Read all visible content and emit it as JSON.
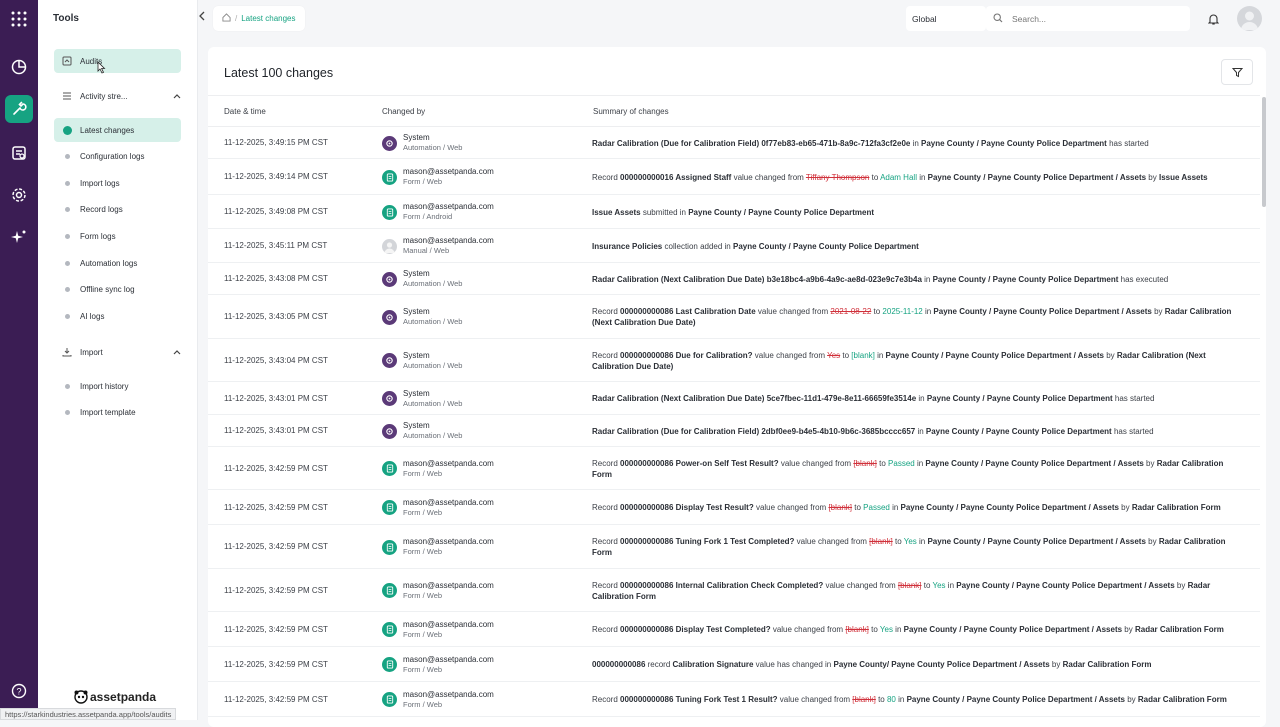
{
  "rail": {
    "icons": [
      "apps-grid-icon",
      "analytics-icon",
      "tools-icon",
      "reports-icon",
      "settings-icon",
      "ai-sparkle-icon",
      "help-icon"
    ]
  },
  "sidebar": {
    "title": "Tools",
    "audits_label": "Audits",
    "activity_label": "Activity stre...",
    "activity_items": [
      {
        "label": "Latest changes"
      },
      {
        "label": "Configuration logs"
      },
      {
        "label": "Import logs"
      },
      {
        "label": "Record logs"
      },
      {
        "label": "Form logs"
      },
      {
        "label": "Automation logs"
      },
      {
        "label": "Offline sync log"
      },
      {
        "label": "AI logs"
      }
    ],
    "import_label": "Import",
    "import_items": [
      {
        "label": "Import history"
      },
      {
        "label": "Import template"
      }
    ],
    "brand": "assetpanda"
  },
  "breadcrumb": {
    "current": "Latest changes"
  },
  "header": {
    "scope": "Global",
    "search_placeholder": "Search..."
  },
  "main": {
    "title": "Latest 100 changes",
    "columns": [
      "Date & time",
      "Changed by",
      "Summary of changes"
    ]
  },
  "rows": [
    {
      "dt": "11-12-2025, 3:49:15 PM CST",
      "who": "System",
      "src": "Automation / Web",
      "kind": "sys",
      "sum": [
        [
          "b",
          "Radar Calibration (Due for Calibration Field)"
        ],
        [
          "b",
          " 0f77eb83-eb65-471b-8a9c-712fa3cf2e0e"
        ],
        [
          "t",
          " in "
        ],
        [
          "b",
          "Payne County / Payne County Police Department"
        ],
        [
          "t",
          " has started"
        ]
      ]
    },
    {
      "dt": "11-12-2025, 3:49:14 PM CST",
      "who": "mason@assetpanda.com",
      "src": "Form / Web",
      "kind": "form",
      "sum": [
        [
          "t",
          "Record "
        ],
        [
          "b",
          "000000000016 Assigned Staff"
        ],
        [
          "t",
          " value changed from "
        ],
        [
          "o",
          "Tiffany Thompson"
        ],
        [
          "t",
          " to "
        ],
        [
          "n",
          "Adam Hall"
        ],
        [
          "t",
          " in "
        ],
        [
          "b",
          "Payne County / Payne County Police Department / Assets"
        ],
        [
          "t",
          " by "
        ],
        [
          "b",
          "Issue Assets"
        ]
      ]
    },
    {
      "dt": "11-12-2025, 3:49:08 PM CST",
      "who": "mason@assetpanda.com",
      "src": "Form / Android",
      "kind": "form",
      "sum": [
        [
          "b",
          "Issue Assets"
        ],
        [
          "t",
          " submitted in "
        ],
        [
          "b",
          "Payne County / Payne County Police Department"
        ]
      ]
    },
    {
      "dt": "11-12-2025, 3:45:11 PM CST",
      "who": "mason@assetpanda.com",
      "src": "Manual / Web",
      "kind": "man",
      "sum": [
        [
          "b",
          "Insurance Policies"
        ],
        [
          "t",
          " collection added in "
        ],
        [
          "b",
          "Payne County / Payne County Police Department"
        ]
      ]
    },
    {
      "dt": "11-12-2025, 3:43:08 PM CST",
      "who": "System",
      "src": "Automation / Web",
      "kind": "sys",
      "sum": [
        [
          "b",
          "Radar Calibration (Next Calibration Due Date) b3e18bc4-a9b6-4a9c-ae8d-023e9c7e3b4a"
        ],
        [
          "t",
          " in "
        ],
        [
          "b",
          "Payne County / Payne County Police Department"
        ],
        [
          "t",
          " has executed"
        ]
      ]
    },
    {
      "dt": "11-12-2025, 3:43:05 PM CST",
      "who": "System",
      "src": "Automation / Web",
      "kind": "sys",
      "sum": [
        [
          "t",
          "Record "
        ],
        [
          "b",
          "000000000086 Last Calibration Date"
        ],
        [
          "t",
          " value changed from "
        ],
        [
          "o",
          "2021-08-22"
        ],
        [
          "t",
          " to "
        ],
        [
          "n",
          "2025-11-12"
        ],
        [
          "t",
          " in "
        ],
        [
          "b",
          "Payne County / Payne County Police Department / Assets"
        ],
        [
          "t",
          " by "
        ],
        [
          "b",
          "Radar Calibration (Next Calibration Due Date)"
        ]
      ]
    },
    {
      "dt": "11-12-2025, 3:43:04 PM CST",
      "who": "System",
      "src": "Automation / Web",
      "kind": "sys",
      "sum": [
        [
          "t",
          "Record "
        ],
        [
          "b",
          "000000000086 Due for Calibration?"
        ],
        [
          "t",
          " value changed from "
        ],
        [
          "o",
          "Yes"
        ],
        [
          "t",
          " to "
        ],
        [
          "n",
          "[blank]"
        ],
        [
          "t",
          " in "
        ],
        [
          "b",
          "Payne County / Payne County Police Department / Assets"
        ],
        [
          "t",
          " by "
        ],
        [
          "b",
          "Radar Calibration (Next Calibration Due Date)"
        ]
      ]
    },
    {
      "dt": "11-12-2025, 3:43:01 PM CST",
      "who": "System",
      "src": "Automation / Web",
      "kind": "sys",
      "sum": [
        [
          "b",
          "Radar Calibration (Next Calibration Due Date) 5ce7fbec-11d1-479e-8e11-66659fe3514e"
        ],
        [
          "t",
          " in "
        ],
        [
          "b",
          "Payne County / Payne County Police Department"
        ],
        [
          "t",
          " has started"
        ]
      ]
    },
    {
      "dt": "11-12-2025, 3:43:01 PM CST",
      "who": "System",
      "src": "Automation / Web",
      "kind": "sys",
      "sum": [
        [
          "b",
          "Radar Calibration (Due for Calibration Field) 2dbf0ee9-b4e5-4b10-9b6c-3685bcccc657"
        ],
        [
          "t",
          " in "
        ],
        [
          "b",
          "Payne County / Payne County Police Department"
        ],
        [
          "t",
          " has started"
        ]
      ]
    },
    {
      "dt": "11-12-2025, 3:42:59 PM CST",
      "who": "mason@assetpanda.com",
      "src": "Form / Web",
      "kind": "form",
      "sum": [
        [
          "t",
          "Record "
        ],
        [
          "b",
          "000000000086 Power-on Self Test Result?"
        ],
        [
          "t",
          " value changed from "
        ],
        [
          "o",
          "[blank]"
        ],
        [
          "t",
          " to "
        ],
        [
          "n",
          "Passed"
        ],
        [
          "t",
          " in "
        ],
        [
          "b",
          "Payne County / Payne County Police Department / Assets"
        ],
        [
          "t",
          " by "
        ],
        [
          "b",
          "Radar Calibration Form"
        ]
      ]
    },
    {
      "dt": "11-12-2025, 3:42:59 PM CST",
      "who": "mason@assetpanda.com",
      "src": "Form / Web",
      "kind": "form",
      "sum": [
        [
          "t",
          "Record "
        ],
        [
          "b",
          "000000000086 Display Test Result?"
        ],
        [
          "t",
          " value changed from "
        ],
        [
          "o",
          "[blank]"
        ],
        [
          "t",
          " to "
        ],
        [
          "n",
          "Passed"
        ],
        [
          "t",
          " in "
        ],
        [
          "b",
          "Payne County / Payne County Police Department / Assets"
        ],
        [
          "t",
          " by "
        ],
        [
          "b",
          "Radar Calibration Form"
        ]
      ]
    },
    {
      "dt": "11-12-2025, 3:42:59 PM CST",
      "who": "mason@assetpanda.com",
      "src": "Form / Web",
      "kind": "form",
      "sum": [
        [
          "t",
          "Record "
        ],
        [
          "b",
          "000000000086 Tuning Fork 1 Test Completed?"
        ],
        [
          "t",
          " value changed from "
        ],
        [
          "o",
          "[blank]"
        ],
        [
          "t",
          " to "
        ],
        [
          "n",
          "Yes"
        ],
        [
          "t",
          " in "
        ],
        [
          "b",
          "Payne County / Payne County Police Department / Assets"
        ],
        [
          "t",
          " by "
        ],
        [
          "b",
          "Radar Calibration Form"
        ]
      ]
    },
    {
      "dt": "11-12-2025, 3:42:59 PM CST",
      "who": "mason@assetpanda.com",
      "src": "Form / Web",
      "kind": "form",
      "sum": [
        [
          "t",
          "Record "
        ],
        [
          "b",
          "000000000086 Internal Calibration Check Completed?"
        ],
        [
          "t",
          " value changed from "
        ],
        [
          "o",
          "[blank]"
        ],
        [
          "t",
          " to "
        ],
        [
          "n",
          "Yes"
        ],
        [
          "t",
          " in "
        ],
        [
          "b",
          "Payne County / Payne County Police Department / Assets"
        ],
        [
          "t",
          " by "
        ],
        [
          "b",
          "Radar Calibration Form"
        ]
      ]
    },
    {
      "dt": "11-12-2025, 3:42:59 PM CST",
      "who": "mason@assetpanda.com",
      "src": "Form / Web",
      "kind": "form",
      "sum": [
        [
          "t",
          "Record "
        ],
        [
          "b",
          "000000000086 Display Test Completed?"
        ],
        [
          "t",
          " value changed from "
        ],
        [
          "o",
          "[blank]"
        ],
        [
          "t",
          " to "
        ],
        [
          "n",
          "Yes"
        ],
        [
          "t",
          " in "
        ],
        [
          "b",
          "Payne County / Payne County Police Department / Assets"
        ],
        [
          "t",
          " by "
        ],
        [
          "b",
          "Radar Calibration Form"
        ]
      ]
    },
    {
      "dt": "11-12-2025, 3:42:59 PM CST",
      "who": "mason@assetpanda.com",
      "src": "Form / Web",
      "kind": "form",
      "sum": [
        [
          "b",
          "000000000086"
        ],
        [
          "t",
          " record "
        ],
        [
          "b",
          "Calibration Signature"
        ],
        [
          "t",
          " value has changed in "
        ],
        [
          "b",
          "Payne County/ Payne County Police Department / Assets"
        ],
        [
          "t",
          " by "
        ],
        [
          "b",
          "Radar Calibration Form"
        ]
      ]
    },
    {
      "dt": "11-12-2025, 3:42:59 PM CST",
      "who": "mason@assetpanda.com",
      "src": "Form / Web",
      "kind": "form",
      "sum": [
        [
          "t",
          "Record "
        ],
        [
          "b",
          "000000000086 Tuning Fork Test 1 Result?"
        ],
        [
          "t",
          " value changed from "
        ],
        [
          "o",
          "[blank]"
        ],
        [
          "t",
          " to "
        ],
        [
          "n",
          "80"
        ],
        [
          "t",
          " in "
        ],
        [
          "b",
          "Payne County / Payne County Police Department / Assets"
        ],
        [
          "t",
          " by "
        ],
        [
          "b",
          "Radar Calibration Form"
        ]
      ]
    }
  ],
  "status_url": "https://starkindustries.assetpanda.app/tools/audits",
  "colors": {
    "rail": "#3b1d54",
    "accent": "#16a382",
    "old_value": "#d0313b"
  }
}
